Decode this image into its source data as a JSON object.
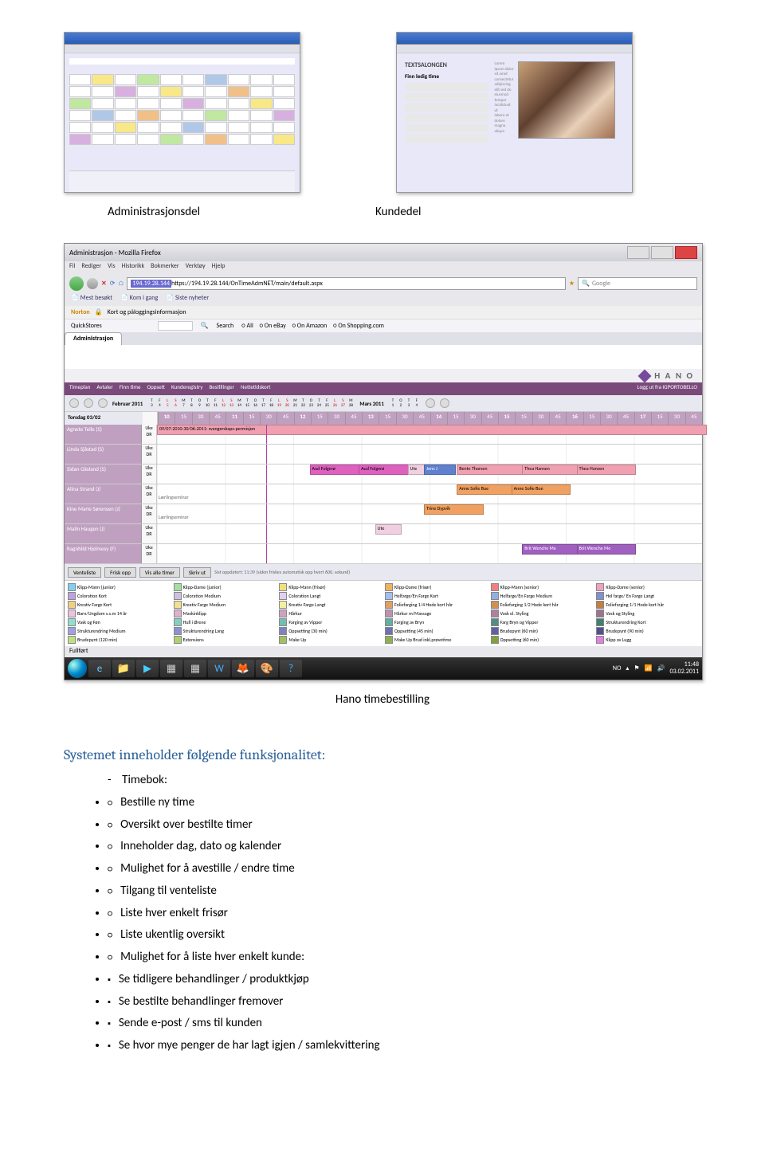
{
  "thumbnails": {
    "thumb2": {
      "textsalongen": "TEXTSALONGEN",
      "finn_ledig": "Finn ledig time"
    }
  },
  "labels": {
    "admin": "Administrasjonsdel",
    "kunde": "Kundedel"
  },
  "firefox": {
    "title": "Administrasjon - Mozilla Firefox",
    "menus": [
      "Fil",
      "Rediger",
      "Vis",
      "Historikk",
      "Bokmerker",
      "Verktøy",
      "Hjelp"
    ],
    "url_host": "194.19.28.144",
    "url_rest": "https://194.19.28.144/OnTimeAdmNET/main/default.aspx",
    "search_placeholder": "Google",
    "bookmarks": [
      "Mest besøkt",
      "Kom i gang",
      "Siste nyheter"
    ],
    "norton": {
      "label": "Norton",
      "item": "Kort og påloggingsinformasjon"
    },
    "quickstores": {
      "label": "QuickStores",
      "search": "Search",
      "radios": [
        "All",
        "On eBay",
        "On Amazon",
        "On Shopping.com"
      ]
    },
    "tab": "Administrasjon",
    "hano": "H A N O",
    "app_menu": [
      "Timeplan",
      "Avtaler",
      "Finn time",
      "Oppsett",
      "Kunderegistry",
      "Bestillinger",
      "Nettetidskort"
    ],
    "app_menu_right": "Logg ut fra IGPORTOBELLO",
    "feb": "Februar 2011",
    "mar": "Mars 2011",
    "day_letters": [
      "T",
      "F",
      "L",
      "S",
      "M",
      "T",
      "O",
      "T",
      "F",
      "L",
      "S",
      "M",
      "T",
      "O",
      "T",
      "F",
      "L",
      "S",
      "M",
      "T",
      "O",
      "T",
      "F",
      "L",
      "S",
      "M"
    ],
    "ruler_date": "Torsdag 03/02",
    "hours": [
      "10",
      "11",
      "12",
      "13",
      "14",
      "15",
      "16",
      "17"
    ],
    "sub_hours": [
      "00",
      "15",
      "30",
      "45"
    ],
    "permisjon": "09/07-2010-30/06-2011: svangerskaps-permisjon",
    "staff": [
      {
        "name": "Agnete Telle (S)",
        "appts": []
      },
      {
        "name": "Linda Sjåstad (S)",
        "appts": []
      },
      {
        "name": "Sidan Gåsland (S)",
        "appts": [
          {
            "cls": "magenta",
            "l": 28,
            "w": 9,
            "label": "Aud Folgerø"
          },
          {
            "cls": "magenta",
            "l": 37,
            "w": 9,
            "label": "Aud Folgerø"
          },
          {
            "cls": "lt",
            "l": 46,
            "w": 3,
            "label": "Ute"
          },
          {
            "cls": "blue",
            "l": 49,
            "w": 5,
            "label": "Jens J"
          },
          {
            "cls": "pink",
            "l": 55,
            "w": 12,
            "label": "Bente Thorsen"
          },
          {
            "cls": "pink",
            "l": 67,
            "w": 10,
            "label": "Thea Hansen"
          },
          {
            "cls": "pink",
            "l": 77,
            "w": 10,
            "label": "Thea Hansen"
          }
        ]
      },
      {
        "name": "Alina Strand (J)",
        "note": "Lærlingseminar",
        "appts": [
          {
            "cls": "orange",
            "l": 55,
            "w": 10,
            "label": "Anne Sofie Bue"
          },
          {
            "cls": "orange",
            "l": 65,
            "w": 10,
            "label": "Anne Sofie Bue"
          }
        ]
      },
      {
        "name": "Kine Marie Sørensen (J)",
        "note": "Lærlingseminar",
        "appts": [
          {
            "cls": "orange",
            "l": 49,
            "w": 10,
            "label": "Trine Dypvik"
          }
        ]
      },
      {
        "name": "Malin Haugen (J)",
        "appts": [
          {
            "cls": "lt",
            "l": 40,
            "w": 4,
            "label": "Ute"
          }
        ]
      },
      {
        "name": "Ragnhild Hjelmesy (F)",
        "appts": [
          {
            "cls": "purple",
            "l": 67,
            "w": 10,
            "label": "Brit Wenche Me"
          },
          {
            "cls": "purple",
            "l": 77,
            "w": 10,
            "label": "Brit Wenche Me"
          }
        ]
      }
    ],
    "btns": [
      "Venteliste",
      "Frisk opp",
      "Vis alle timer",
      "Skriv ut"
    ],
    "btn_status": "Sist oppdatert: 11:39 (siden friskes automatisk opp hvert 600. sekund)",
    "status_left": "Fullført",
    "legend": [
      {
        "c": "#80d0f0",
        "t": "Klipp-Mann (junior)"
      },
      {
        "c": "#a0e0a0",
        "t": "Klipp-Dame (junior)"
      },
      {
        "c": "#f0e080",
        "t": "Klipp-Mann (frisør)"
      },
      {
        "c": "#f0b060",
        "t": "Klipp-Dame (frisør)"
      },
      {
        "c": "#f08080",
        "t": "Klipp-Mann (senior)"
      },
      {
        "c": "#f0a0c0",
        "t": "Klipp-Dame (senior)"
      },
      {
        "c": "#c0a0e0",
        "t": "Coloration Kort"
      },
      {
        "c": "#d0c0e0",
        "t": "Coloration Medium"
      },
      {
        "c": "#e0d0f0",
        "t": "Coloration Langt"
      },
      {
        "c": "#a0c0f0",
        "t": "Helfarge/En Farge Kort"
      },
      {
        "c": "#90b0e0",
        "t": "Helfarge/En Farge Medium"
      },
      {
        "c": "#8090d0",
        "t": "Hel farge/ En Farge Langt"
      },
      {
        "c": "#f0d080",
        "t": "Kreativ Farge Kort"
      },
      {
        "c": "#f0e090",
        "t": "Kreativ Farge Medium"
      },
      {
        "c": "#f0f0a0",
        "t": "Kreativ Farge Langt"
      },
      {
        "c": "#e0a060",
        "t": "Foliefarging 1/4 Hode kort hår"
      },
      {
        "c": "#d09050",
        "t": "Foliefarging 1/2 Hode kort hår"
      },
      {
        "c": "#c08040",
        "t": "Foliefarging 1/1 Hode kort hår"
      },
      {
        "c": "#f0c0e0",
        "t": "Barn/Ungdom s.s.m 14 år"
      },
      {
        "c": "#e0b0d0",
        "t": "Maskinklipp"
      },
      {
        "c": "#d0a0c0",
        "t": "Hårkur"
      },
      {
        "c": "#c090b0",
        "t": "Hårkur m/Massage"
      },
      {
        "c": "#b080a0",
        "t": "Vask el. Styling"
      },
      {
        "c": "#a07090",
        "t": "Vask og Styling"
      },
      {
        "c": "#90e0d0",
        "t": "Vask og Føn"
      },
      {
        "c": "#80d0c0",
        "t": "Hull i Ørene"
      },
      {
        "c": "#70c0b0",
        "t": "Farging av Vipper"
      },
      {
        "c": "#60b0a0",
        "t": "Farging av Bryn"
      },
      {
        "c": "#509080",
        "t": "Farg Bryn og Vipper"
      },
      {
        "c": "#408070",
        "t": "Strukturendring Kort"
      },
      {
        "c": "#a0a0e0",
        "t": "Strukturendring Medium"
      },
      {
        "c": "#9090d0",
        "t": "Strukturendring Lang"
      },
      {
        "c": "#8080c0",
        "t": "Oppsetting (30 min)"
      },
      {
        "c": "#7070b0",
        "t": "Oppsetting (45 min)"
      },
      {
        "c": "#6060a0",
        "t": "Brudepynt (60 min)"
      },
      {
        "c": "#505090",
        "t": "Brudepynt (90 min)"
      },
      {
        "c": "#c0e080",
        "t": "Brudepynt (120 min)"
      },
      {
        "c": "#b0d070",
        "t": "Extensions"
      },
      {
        "c": "#a0c060",
        "t": "Make Up"
      },
      {
        "c": "#90b050",
        "t": "Make Up Brud inkl.prøvetime"
      },
      {
        "c": "#80a040",
        "t": "Oppsetting (60 min)"
      },
      {
        "c": "#e080e0",
        "t": "Klipp av Lugg"
      }
    ],
    "tray": {
      "lang": "NO",
      "time": "11:48",
      "date": "03.02.2011"
    }
  },
  "caption": "Hano timebestilling",
  "section": {
    "heading": "Systemet inneholder følgende funksjonalitet:",
    "top_item": "Timebok:",
    "items": [
      "Bestille ny time",
      "Oversikt over bestilte timer",
      "Inneholder dag, dato og kalender",
      "Mulighet for å avestille / endre time",
      "Tilgang til venteliste",
      "Liste hver enkelt frisør",
      "Liste ukentlig oversikt",
      "Mulighet for å liste hver enkelt kunde:"
    ],
    "sub_items": [
      "Se tidligere behandlinger / produktkjøp",
      "Se bestilte behandlinger fremover",
      "Sende e-post / sms til kunden",
      "Se hvor mye penger de har lagt igjen / samlekvittering"
    ]
  }
}
